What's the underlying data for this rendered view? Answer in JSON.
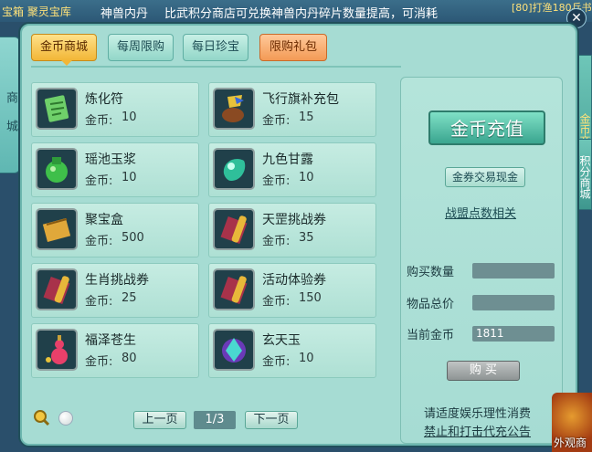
{
  "banner": {
    "left_fragment": "宝箱 聚灵宝库",
    "ticker_1": "神兽内丹",
    "ticker_2": "比武积分商店可兑换神兽内丹碎片数量提高，可消耗",
    "right_fragment": "[80]打渔180兵书"
  },
  "side_left": {
    "label": "商城"
  },
  "side_right": {
    "label_1": "金币商城",
    "label_2": "积分商城"
  },
  "bottom_right": {
    "label": "外观商"
  },
  "tabs": [
    {
      "label": "金币商城",
      "active": true
    },
    {
      "label": "每周限购",
      "active": false
    },
    {
      "label": "每日珍宝",
      "active": false
    },
    {
      "label": "限购礼包",
      "active": false
    }
  ],
  "items": [
    {
      "name": "炼化符",
      "price_label": "金币:",
      "price": "10",
      "icon": "talisman-icon"
    },
    {
      "name": "飞行旗补充包",
      "price_label": "金币:",
      "price": "15",
      "icon": "flag-bag-icon"
    },
    {
      "name": "瑶池玉浆",
      "price_label": "金币:",
      "price": "10",
      "icon": "jade-pot-icon"
    },
    {
      "name": "九色甘露",
      "price_label": "金币:",
      "price": "10",
      "icon": "dew-gem-icon"
    },
    {
      "name": "聚宝盒",
      "price_label": "金币:",
      "price": "500",
      "icon": "treasure-box-icon"
    },
    {
      "name": "天罡挑战券",
      "price_label": "金币:",
      "price": "35",
      "icon": "scroll-icon"
    },
    {
      "name": "生肖挑战券",
      "price_label": "金币:",
      "price": "25",
      "icon": "scroll-icon"
    },
    {
      "name": "活动体验券",
      "price_label": "金币:",
      "price": "150",
      "icon": "scroll-icon"
    },
    {
      "name": "福泽苍生",
      "price_label": "金币:",
      "price": "80",
      "icon": "gourd-icon"
    },
    {
      "name": "玄天玉",
      "price_label": "金币:",
      "price": "10",
      "icon": "jade-crystal-icon"
    }
  ],
  "right": {
    "recharge_label": "金币充值",
    "exchange_label": "金券交易现金",
    "alliance_label": "战盟点数相关",
    "buy_qty_label": "购买数量",
    "buy_qty_value": "",
    "total_label": "物品总价",
    "total_value": "",
    "current_label": "当前金币",
    "current_value": "1811",
    "buy_label": "购 买"
  },
  "pager": {
    "prev_label": "上一页",
    "page": "1/3",
    "next_label": "下一页"
  },
  "notices": {
    "line1": "请适度娱乐理性消费",
    "line2": "禁止和打击代充公告"
  }
}
